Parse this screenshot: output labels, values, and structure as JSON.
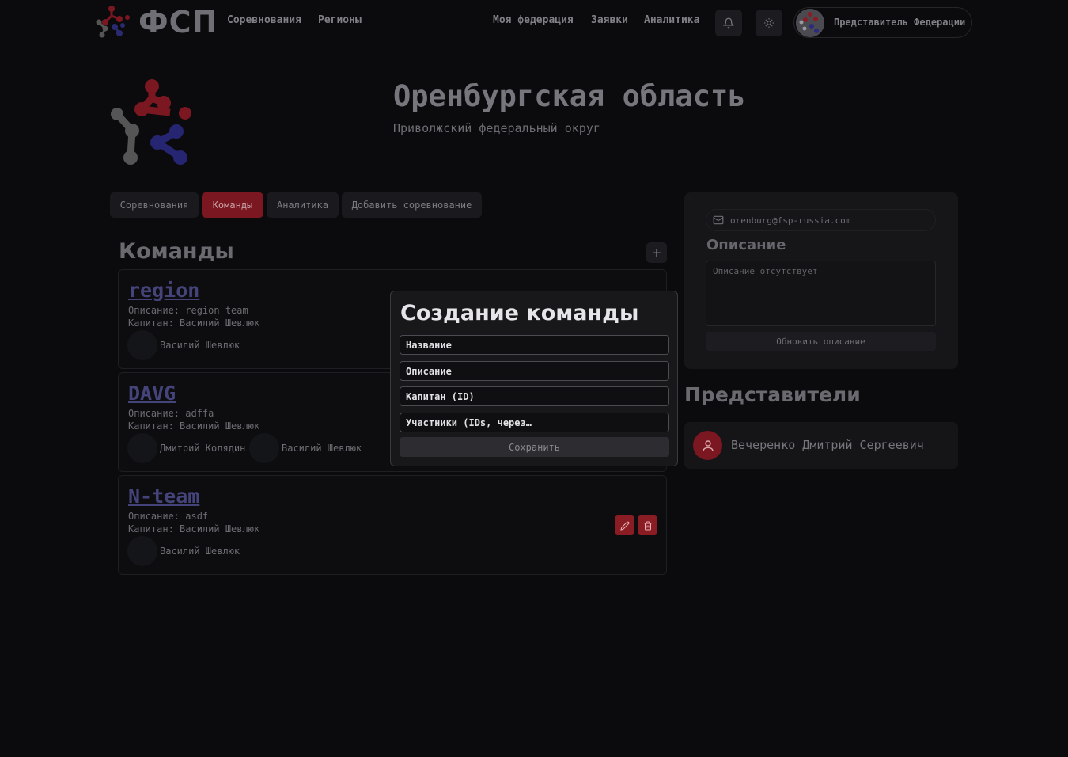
{
  "header": {
    "logo_text": "ФСП",
    "nav_left": [
      "Соревнования",
      "Регионы"
    ],
    "nav_right": [
      "Моя федерация",
      "Заявки",
      "Аналитика"
    ],
    "user_role": "Представитель Федерации"
  },
  "region": {
    "title": "Оренбургская область",
    "subtitle": "Приволжский федеральный округ"
  },
  "tabs": [
    {
      "label": "Соревнования",
      "active": false
    },
    {
      "label": "Команды",
      "active": true
    },
    {
      "label": "Аналитика",
      "active": false
    },
    {
      "label": "Добавить соревнование",
      "active": false
    }
  ],
  "teams_section": {
    "title": "Команды",
    "add_label": "+",
    "teams": [
      {
        "name": "region",
        "description": "Описание: region team",
        "captain": "Капитан: Василий Шевлюк",
        "members": [
          "Василий Шевлюк"
        ]
      },
      {
        "name": "DAVG",
        "description": "Описание: adffa",
        "captain": "Капитан: Василий Шевлюк",
        "members": [
          "Дмитрий Колядин",
          "Василий Шевлюк"
        ]
      },
      {
        "name": "N-team",
        "description": "Описание: asdf",
        "captain": "Капитан: Василий Шевлюк",
        "members": [
          "Василий Шевлюк"
        ]
      }
    ]
  },
  "info_panel": {
    "email": "orenburg@fsp-russia.com",
    "description_title": "Описание",
    "description_placeholder": "Описание отсутствует",
    "update_button": "Обновить описание"
  },
  "representatives": {
    "title": "Представители",
    "items": [
      {
        "name": "Вечеренко Дмитрий Сергеевич"
      }
    ]
  },
  "modal": {
    "title": "Создание команды",
    "fields": {
      "name": "Название",
      "description": "Описание",
      "captain": "Капитан (ID)",
      "members": "Участники (IDs, через…"
    },
    "save_button": "Сохранить"
  },
  "colors": {
    "background": "#0b0b0d",
    "accent_red": "#7a1720",
    "link_blue": "#44447a"
  }
}
